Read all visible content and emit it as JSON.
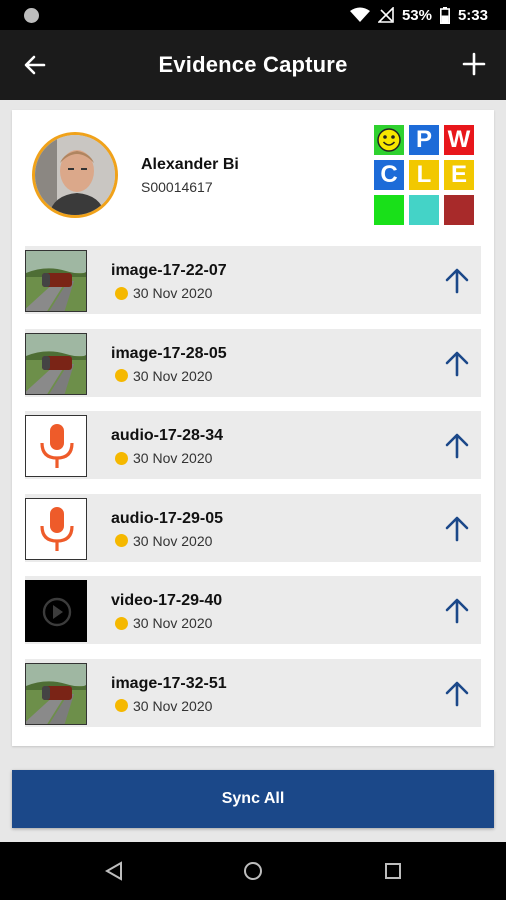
{
  "statusbar": {
    "battery": "53%",
    "time": "5:33"
  },
  "appbar": {
    "title": "Evidence Capture"
  },
  "profile": {
    "name": "Alexander Bi",
    "id": "S00014617"
  },
  "grid": {
    "cells": [
      {
        "label": "",
        "color": "#2fd12f"
      },
      {
        "label": "P",
        "color": "#1d6bd8"
      },
      {
        "label": "W",
        "color": "#e8161b"
      },
      {
        "label": "C",
        "color": "#1d6bd8"
      },
      {
        "label": "L",
        "color": "#f2c800"
      },
      {
        "label": "E",
        "color": "#f2c800"
      },
      {
        "label": "",
        "color": "#19e019"
      },
      {
        "label": "",
        "color": "#44d3c7"
      },
      {
        "label": "",
        "color": "#a82a2a"
      }
    ]
  },
  "items": [
    {
      "name": "image-17-22-07",
      "date": "30 Nov 2020",
      "type": "image"
    },
    {
      "name": "image-17-28-05",
      "date": "30 Nov 2020",
      "type": "image"
    },
    {
      "name": "audio-17-28-34",
      "date": "30 Nov 2020",
      "type": "audio"
    },
    {
      "name": "audio-17-29-05",
      "date": "30 Nov 2020",
      "type": "audio"
    },
    {
      "name": "video-17-29-40",
      "date": "30 Nov 2020",
      "type": "video"
    },
    {
      "name": "image-17-32-51",
      "date": "30 Nov 2020",
      "type": "image"
    }
  ],
  "actions": {
    "sync_label": "Sync All"
  },
  "colors": {
    "accent": "#1b4889",
    "status_pending": "#f5b800",
    "avatar_ring": "#f0a21a"
  }
}
